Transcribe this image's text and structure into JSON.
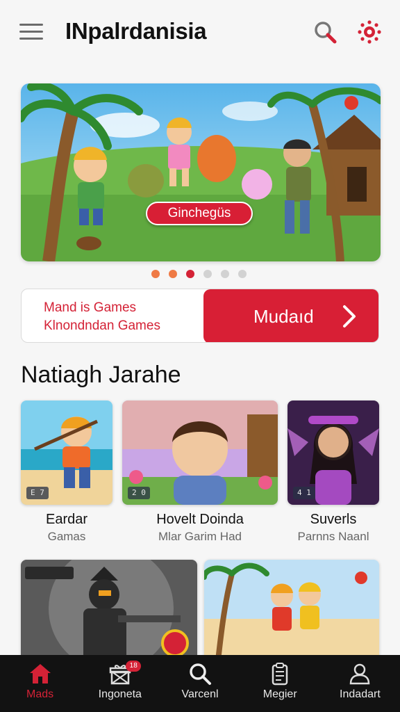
{
  "header": {
    "title": "INpalrdanisia",
    "menu_icon": "hamburger-menu-icon",
    "search_icon": "search-icon",
    "settings_icon": "gear-icon",
    "accent": "#d42236"
  },
  "hero": {
    "cta_label": "Ginchegüs",
    "carousel": {
      "total": 6,
      "active_index": 2
    }
  },
  "promo": {
    "line1": "Mand is Games",
    "line2": "Klnondndan Games",
    "button_label": "Mudaıd",
    "button_icon": "chevron-right-icon"
  },
  "section": {
    "title": "Natiagh Jarahe"
  },
  "games": [
    {
      "name": "Eardar",
      "subtitle": "Gamas",
      "badge": "E 7"
    },
    {
      "name": "Hovelt Doinda",
      "subtitle": "Mlar Garim Had",
      "badge": "2 0"
    },
    {
      "name": "Suverls",
      "subtitle": "Parnns Naanl",
      "badge": "4 1"
    },
    {
      "name": "",
      "subtitle": "",
      "badge": ""
    },
    {
      "name": "",
      "subtitle": "",
      "badge": ""
    }
  ],
  "bottom_nav": [
    {
      "label": "Mads",
      "icon": "home-icon",
      "active": true
    },
    {
      "label": "Ingoneta",
      "icon": "gift-box-icon",
      "badge": "18"
    },
    {
      "label": "Varcenl",
      "icon": "search-icon"
    },
    {
      "label": "Megier",
      "icon": "clipboard-icon"
    },
    {
      "label": "Indadart",
      "icon": "user-icon"
    }
  ]
}
